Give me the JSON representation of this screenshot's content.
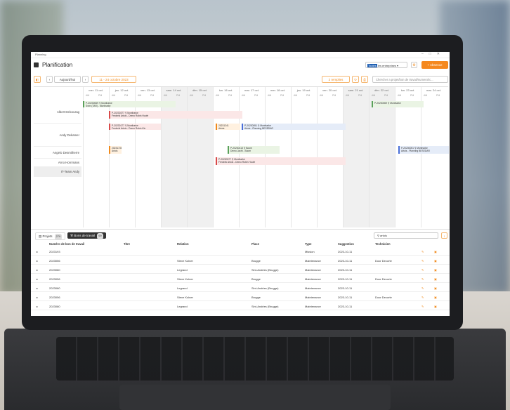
{
  "window": {
    "title": "Planning"
  },
  "header": {
    "title": "Planification",
    "company_select_hl": "Toutes",
    "company_select_rest": "les entreprises",
    "absence_label": "+ Absence"
  },
  "toolbar": {
    "today": "Aujourd'hui",
    "range": "11 - 24 octobre 2023",
    "filter": "2 remplies",
    "search_placeholder": "Chercher a projet/bon de travail/numero/ic..."
  },
  "days": [
    {
      "label": "mer. 11 oct."
    },
    {
      "label": "jeu. 12 oct."
    },
    {
      "label": "ven. 13 oct."
    },
    {
      "label": "sam. 14 oct."
    },
    {
      "label": "dim. 15 oct."
    },
    {
      "label": "lun. 16 oct."
    },
    {
      "label": "mar. 17 oct."
    },
    {
      "label": "mer. 18 oct."
    },
    {
      "label": "jeu. 19 oct."
    },
    {
      "label": "ven. 20 oct."
    },
    {
      "label": "sam. 21 oct."
    },
    {
      "label": "dim. 22 oct."
    },
    {
      "label": "lun. 23 oct."
    },
    {
      "label": "mar. 24 oct."
    }
  ],
  "ampm": {
    "am": "AM",
    "pm": "PM"
  },
  "resources": [
    "Albert Delcourag",
    "Andy Dekamer",
    "Angelo Desmitherre",
    "Arno Hornmans",
    "IT-Team Andy"
  ],
  "events": [
    {
      "t": "P-20230069",
      "s": "Sven (TAR) - Montharke",
      "loc": "Montharke"
    },
    {
      "t": "P-20230377",
      "s": "Frederik Artois - Demo Robin Hoofe",
      "loc": "Montharke"
    },
    {
      "t": "P-20230177",
      "s": "Frederik Artois - Demo Robin Kle",
      "loc": "Montharke"
    },
    {
      "t": "20231241",
      "s": "Artois"
    },
    {
      "t": "P-20230051",
      "s": "Artois - Planning BESEDAR",
      "loc": "Montharke"
    },
    {
      "t": "20231738",
      "s": "Artois"
    },
    {
      "t": "P-20230413",
      "s": "Demo Jacht - Boom",
      "loc": "Boom"
    },
    {
      "t": "P-20230051",
      "s": "Artois - Planning BESEDAR",
      "loc": "Montharke"
    },
    {
      "t": "P-20230377",
      "s": "Frederik Artois - Demo Robin Hoofe",
      "loc": "Montharke"
    },
    {
      "t": "P-20230069",
      "s": "",
      "loc": "Montharke"
    }
  ],
  "panel": {
    "tab1": "Projets",
    "tab1_count": "279",
    "tab2": "Bons de travail",
    "tab2_count": "69",
    "filter_value": "artois"
  },
  "columns": {
    "num": "Numéro de bon de travail",
    "title": "Titre",
    "relation": "Relation",
    "place": "Place",
    "type": "Type",
    "suggestion": "Suggestion",
    "tech": "Technicien"
  },
  "rows": [
    {
      "n": "2023193",
      "rel": "",
      "place": "",
      "type": "Mission",
      "date": "2023-10-11",
      "tech": ""
    },
    {
      "n": "2023056",
      "rel": "Steve Kolner",
      "place": "Brugge",
      "type": "Maintenance",
      "date": "2023-10-11",
      "tech": "Door Decorte"
    },
    {
      "n": "2023080",
      "rel": "Legrand",
      "place": "Sint-Andries (Brugge)",
      "type": "Maintenance",
      "date": "2023-10-11",
      "tech": ""
    },
    {
      "n": "2023056",
      "rel": "Steve Kolner",
      "place": "Brugge",
      "type": "Maintenance",
      "date": "2023-10-11",
      "tech": "Door Decorte"
    },
    {
      "n": "2023080",
      "rel": "Legrand",
      "place": "Sint-Andries (Brugge)",
      "type": "Maintenance",
      "date": "2023-10-11",
      "tech": ""
    },
    {
      "n": "2023056",
      "rel": "Steve Kolner",
      "place": "Brugge",
      "type": "Maintenance",
      "date": "2023-10-11",
      "tech": "Door Decorte"
    },
    {
      "n": "2023080",
      "rel": "Legrand",
      "place": "Sint-Andries (Brugge)",
      "type": "Maintenance",
      "date": "2023-10-11",
      "tech": ""
    }
  ]
}
